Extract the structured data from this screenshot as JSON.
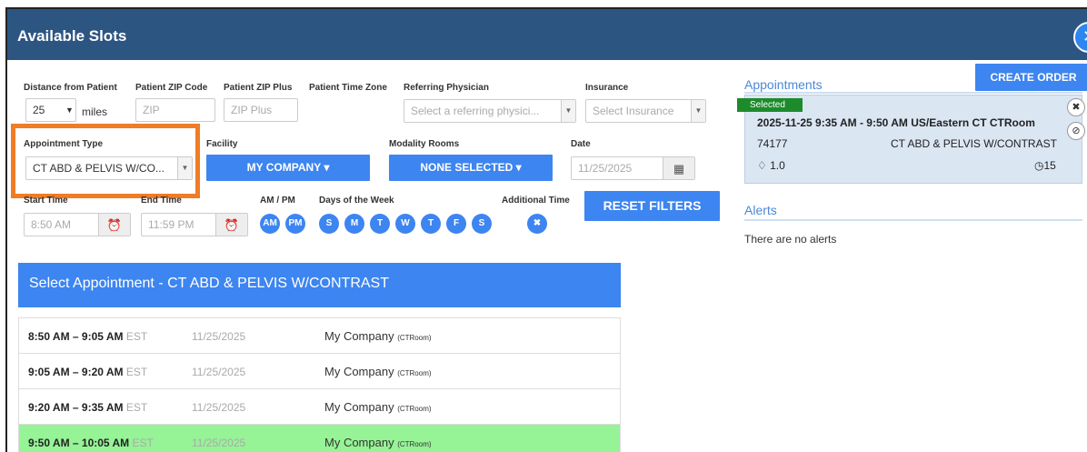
{
  "window": {
    "title": "Available Slots",
    "close_icon": "✕"
  },
  "filters": {
    "distance_label": "Distance from Patient",
    "distance_value": "25",
    "distance_unit": "miles",
    "zip_label": "Patient ZIP Code",
    "zip_placeholder": "ZIP",
    "zip_plus_label": "Patient ZIP Plus",
    "zip_plus_placeholder": "ZIP Plus",
    "timezone_label": "Patient Time Zone",
    "referring_label": "Referring Physician",
    "referring_placeholder": "Select a referring physici...",
    "insurance_label": "Insurance",
    "insurance_placeholder": "Select Insurance",
    "appt_type_label": "Appointment Type",
    "appt_type_value": "CT ABD & PELVIS W/CO...",
    "facility_label": "Facility",
    "facility_value": "MY COMPANY ▾",
    "modality_label": "Modality Rooms",
    "modality_value": "NONE SELECTED ▾",
    "date_label": "Date",
    "date_value": "11/25/2025",
    "start_label": "Start Time",
    "start_value": "8:50 AM",
    "end_label": "End Time",
    "end_value": "11:59 PM",
    "ampm_label": "AM / PM",
    "am": "AM",
    "pm": "PM",
    "days_label": "Days of the Week",
    "days": [
      "S",
      "M",
      "T",
      "W",
      "T",
      "F",
      "S"
    ],
    "additional_label": "Additional Time",
    "reset_label": "RESET FILTERS"
  },
  "slots": {
    "header": "Select Appointment - CT ABD & PELVIS W/CONTRAST",
    "rows": [
      {
        "time": "8:50 AM – 9:05 AM",
        "tz": "EST",
        "date": "11/25/2025",
        "facility": "My Company",
        "room": "(CTRoom)"
      },
      {
        "time": "9:05 AM – 9:20 AM",
        "tz": "EST",
        "date": "11/25/2025",
        "facility": "My Company",
        "room": "(CTRoom)"
      },
      {
        "time": "9:20 AM – 9:35 AM",
        "tz": "EST",
        "date": "11/25/2025",
        "facility": "My Company",
        "room": "(CTRoom)"
      },
      {
        "time": "9:50 AM – 10:05 AM",
        "tz": "EST",
        "date": "11/25/2025",
        "facility": "My Company",
        "room": "(CTRoom)"
      }
    ]
  },
  "right": {
    "create_order": "CREATE ORDER",
    "appointments_label": "Appointments",
    "selected_badge": "Selected",
    "appt_line": "2025-11-25 9:35 AM - 9:50 AM US/Eastern CT CTRoom",
    "appt_code": "74177",
    "appt_desc": "CT ABD & PELVIS W/CONTRAST",
    "appt_rvu": "1.0",
    "appt_minutes": "15",
    "alerts_label": "Alerts",
    "alerts_text": "There are no alerts"
  },
  "colors": {
    "titlebar": "#2d5582",
    "accent": "#3d85f0",
    "selected_row": "#96f396",
    "highlight": "#f07c26",
    "badge": "#1d8b2c"
  }
}
